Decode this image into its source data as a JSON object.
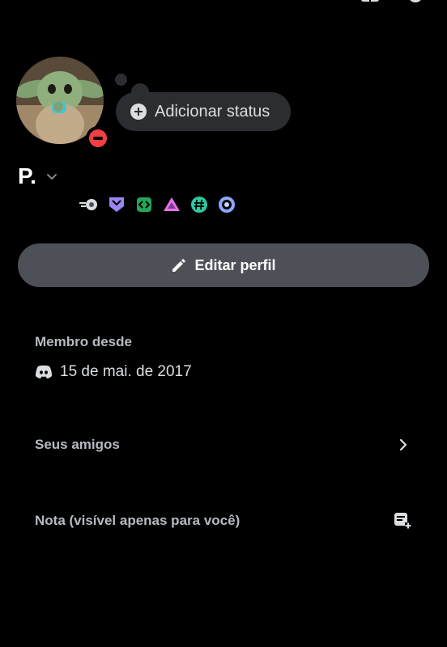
{
  "profile": {
    "display_name": "P.",
    "status_prompt": "Adicionar status",
    "presence": "do-not-disturb",
    "badges": [
      "speed-badge-icon",
      "hypesquad-badge-icon",
      "active-developer-badge-icon",
      "nitro-triangle-badge-icon",
      "hashtag-badge-icon",
      "boost-badge-icon"
    ]
  },
  "actions": {
    "edit_profile": "Editar perfil"
  },
  "member_since": {
    "label": "Membro desde",
    "date": "15 de mai. de 2017"
  },
  "friends": {
    "label": "Seus amigos"
  },
  "note": {
    "label": "Nota (visível apenas para você)"
  },
  "colors": {
    "background": "#000000",
    "button": "#4e5058",
    "dnd": "#f23f43",
    "secondary_text": "#b5bac1"
  }
}
